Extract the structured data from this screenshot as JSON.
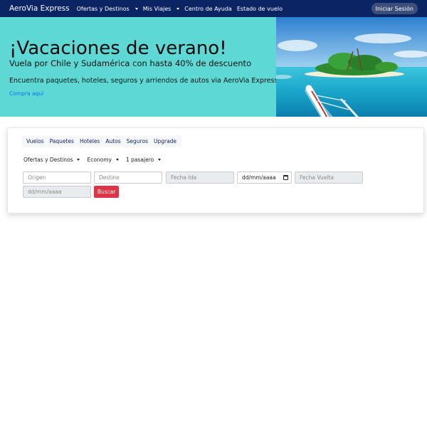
{
  "navbar": {
    "brand": "AeroVia Express",
    "items": [
      {
        "label": "Ofertas y Destinos",
        "dropdown": true
      },
      {
        "label": "Mis Viajes",
        "dropdown": true
      },
      {
        "label": "Centro de Ayuda",
        "dropdown": false
      },
      {
        "label": "Estado de vuelo",
        "dropdown": false
      }
    ],
    "login": "Iniciar Sesión"
  },
  "hero": {
    "title": "¡Vacaciones de verano!",
    "subtitle": "Vuela por Chile y Sudamérica con hasta 40% de descuento",
    "description": "Encuentra paquetes, hoteles, seguros y arriendos de autos via AeroVia Express",
    "link": "Compra aquí",
    "image_icon": "tropical-island-image",
    "background_color": "#5dd8d5"
  },
  "search": {
    "tabs": [
      "Vuelos",
      "Paquetes",
      "Hoteles",
      "Autos",
      "Seguros",
      "Upgrade"
    ],
    "selects": {
      "category": "Ofertas y Destinos",
      "cabin": "Economy",
      "passengers": "1 pasajero"
    },
    "origin_placeholder": "Origen",
    "destination_placeholder": "Destino",
    "departure_label": "Fecha Ida",
    "departure_date": "dd/mm/aaaa",
    "return_label": "Fecha Vuelta",
    "return_date": "dd/mm/aaaa",
    "submit": "Buscar"
  },
  "colors": {
    "navbar": "#0b2463",
    "accent_link": "#0d6efd",
    "search_button": "#dc3545"
  }
}
